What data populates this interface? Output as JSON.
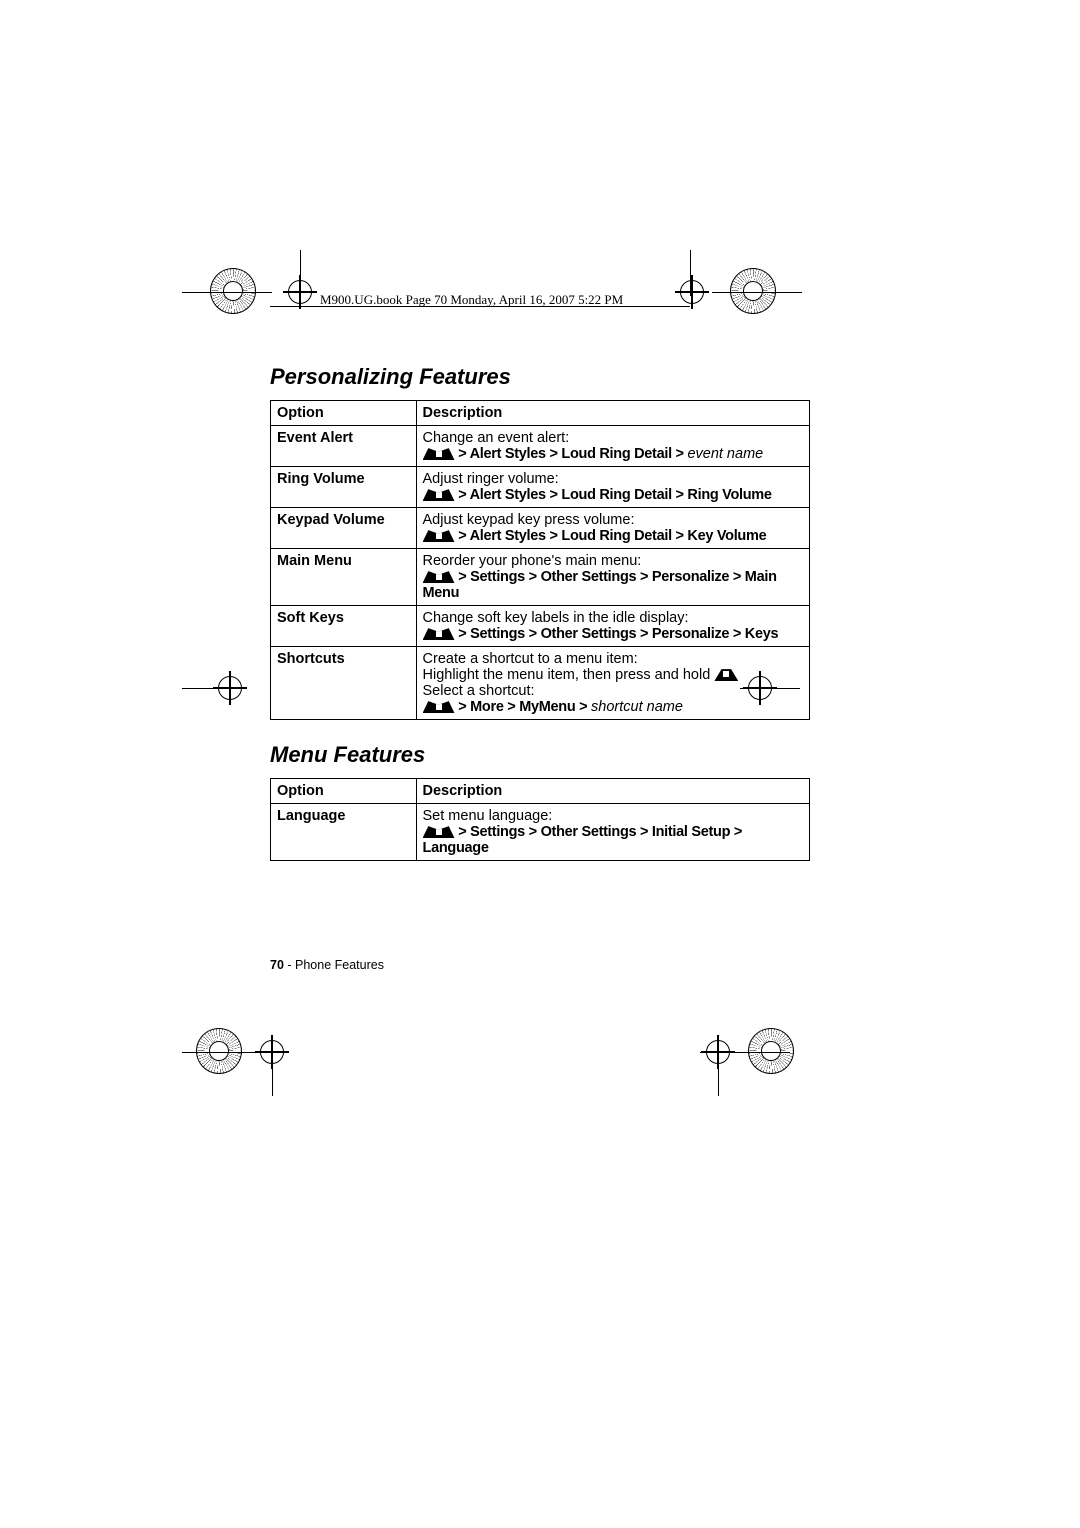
{
  "book_header": "M900.UG.book  Page 70  Monday, April 16, 2007  5:22 PM",
  "sections": {
    "personalizing": {
      "title": "Personalizing Features",
      "headers": {
        "option": "Option",
        "description": "Description"
      },
      "rows": {
        "event_alert": {
          "option": "Event Alert",
          "desc_lead": "Change an event alert:",
          "path_a": " > Alert Styles > Loud Ring Detail > ",
          "path_b": "event name"
        },
        "ring_volume": {
          "option": "Ring Volume",
          "desc_lead": "Adjust ringer volume:",
          "path": "  > Alert Styles > Loud Ring Detail > Ring Volume"
        },
        "keypad_volume": {
          "option": "Keypad Volume",
          "desc_lead": "Adjust keypad key press volume:",
          "path": "  > Alert Styles > Loud Ring Detail > Key Volume"
        },
        "main_menu": {
          "option": "Main Menu",
          "desc_lead": "Reorder your phone's main menu:",
          "path": " > Settings > Other Settings > Personalize > Main Menu"
        },
        "soft_keys": {
          "option": "Soft Keys",
          "desc_lead": "Change soft key labels in the idle display:",
          "path": " > Settings > Other Settings > Personalize > Keys"
        },
        "shortcuts": {
          "option": "Shortcuts",
          "desc_a": "Create a shortcut to a menu item:",
          "desc_b": "Highlight the menu item, then press and hold",
          "desc_c": "Select a shortcut:",
          "path_a": " > More > MyMenu > ",
          "path_b": "shortcut name"
        }
      }
    },
    "menu": {
      "title": "Menu Features",
      "headers": {
        "option": "Option",
        "description": "Description"
      },
      "rows": {
        "language": {
          "option": "Language",
          "desc_lead": "Set menu language:",
          "path": " > Settings > Other Settings > Initial Setup > Language"
        }
      }
    }
  },
  "footer": {
    "page_num": "70",
    "section": " - Phone Features"
  }
}
